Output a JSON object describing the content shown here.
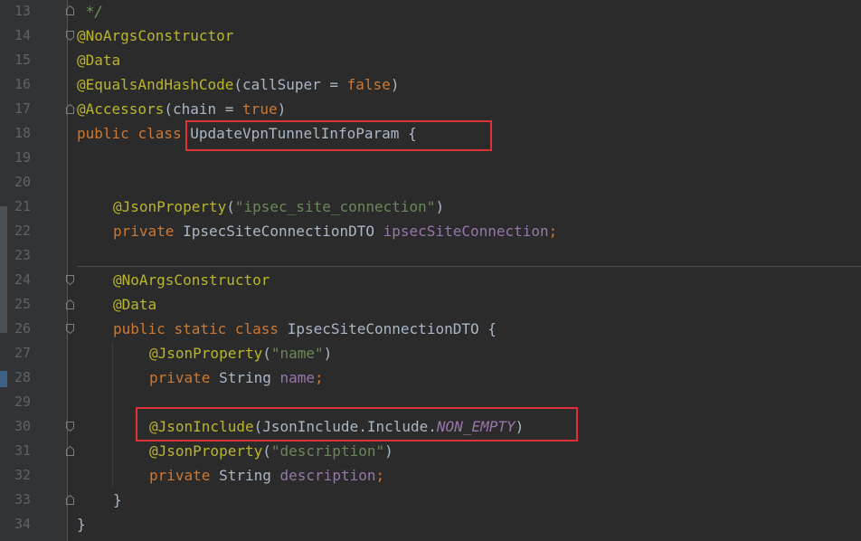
{
  "editor": {
    "colors": {
      "background": "#2b2b2b",
      "gutter": "#313335",
      "keyword": "#cc7832",
      "annotation": "#bbb529",
      "string": "#6a8759",
      "field": "#9876aa",
      "text": "#a9b7c6",
      "highlight_box": "#e0313b"
    },
    "line_numbers": [
      "13",
      "14",
      "15",
      "16",
      "17",
      "18",
      "19",
      "20",
      "21",
      "22",
      "23",
      "24",
      "25",
      "26",
      "27",
      "28",
      "29",
      "30",
      "31",
      "32",
      "33",
      "34"
    ],
    "lines": {
      "l13": {
        "comment": " */"
      },
      "l14": {
        "annotation": "@NoArgsConstructor"
      },
      "l15": {
        "annotation": "@Data"
      },
      "l16": {
        "annotation": "@EqualsAndHashCode",
        "open": "(",
        "param": "callSuper",
        "eq": " = ",
        "value": "false",
        "close": ")"
      },
      "l17": {
        "annotation": "@Accessors",
        "open": "(",
        "param": "chain",
        "eq": " = ",
        "value": "true",
        "close": ")"
      },
      "l18": {
        "kw1": "public",
        "kw2": "class",
        "name": "UpdateVpnTunnelInfoParam",
        "brace": "{"
      },
      "l21": {
        "annotation": "@JsonProperty",
        "open": "(",
        "string": "\"ipsec_site_connection\"",
        "close": ")"
      },
      "l22": {
        "kw": "private",
        "type": "IpsecSiteConnectionDTO",
        "field": "ipsecSiteConnection",
        "semi": ";"
      },
      "l24": {
        "annotation": "@NoArgsConstructor"
      },
      "l25": {
        "annotation": "@Data"
      },
      "l26": {
        "kw1": "public",
        "kw2": "static",
        "kw3": "class",
        "name": "IpsecSiteConnectionDTO",
        "brace": "{"
      },
      "l27": {
        "annotation": "@JsonProperty",
        "open": "(",
        "string": "\"name\"",
        "close": ")"
      },
      "l28": {
        "kw": "private",
        "type": "String",
        "field": "name",
        "semi": ";"
      },
      "l30": {
        "annotation": "@JsonInclude",
        "open": "(",
        "cls": "JsonInclude",
        "dot1": ".",
        "inner": "Include",
        "dot2": ".",
        "const": "NON_EMPTY",
        "close": ")"
      },
      "l31": {
        "annotation": "@JsonProperty",
        "open": "(",
        "string": "\"description\"",
        "close": ")"
      },
      "l32": {
        "kw": "private",
        "type": "String",
        "field": "description",
        "semi": ";"
      },
      "l33": {
        "brace": "}"
      },
      "l34": {
        "brace": "}"
      }
    }
  }
}
